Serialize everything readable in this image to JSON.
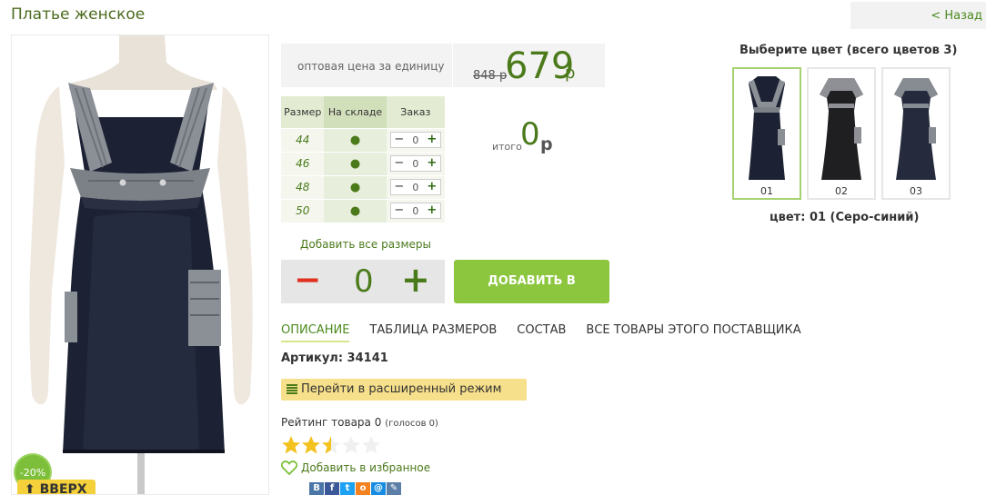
{
  "header": {
    "title": "Платье женское",
    "back_label": "< Назад"
  },
  "photo": {
    "discount": "-20%",
    "up_label": "⬆ ВВЕРХ"
  },
  "price": {
    "label": "оптовая цена за единицу",
    "old": "848 р",
    "new": "679",
    "currency": "р"
  },
  "sizes": {
    "headers": {
      "size": "Размер",
      "stock": "На складе",
      "order": "Заказ"
    },
    "rows": [
      {
        "size": "44",
        "stock": "●",
        "qty": "0"
      },
      {
        "size": "46",
        "stock": "●",
        "qty": "0"
      },
      {
        "size": "48",
        "stock": "●",
        "qty": "0"
      },
      {
        "size": "50",
        "stock": "●",
        "qty": "0"
      }
    ],
    "minus": "−",
    "plus": "+"
  },
  "total": {
    "label": "итого",
    "value": "0",
    "currency": "р"
  },
  "add_all_label": "Добавить все размеры",
  "stepper": {
    "minus": "−",
    "value": "0",
    "plus": "+"
  },
  "cart_button": "ДОБАВИТЬ В КОРЗИНУ",
  "tabs": [
    {
      "label": "ОПИСАНИЕ"
    },
    {
      "label": "ТАБЛИЦА РАЗМЕРОВ"
    },
    {
      "label": "СОСТАВ"
    },
    {
      "label": "ВСЕ ТОВАРЫ ЭТОГО ПОСТАВЩИКА"
    }
  ],
  "sku": "Артикул: 34141",
  "extended_mode": "Перейти в расширенный режим",
  "rating": {
    "label": "Рейтинг товара 0",
    "votes": "(голосов 0)",
    "stars": 2.5,
    "max_stars": 5
  },
  "favorite": "Добавить в избранное",
  "social": [
    {
      "icon": "vk-icon",
      "glyph": "В",
      "color": "#4a76a8"
    },
    {
      "icon": "facebook-icon",
      "glyph": "f",
      "color": "#3b5998"
    },
    {
      "icon": "twitter-icon",
      "glyph": "t",
      "color": "#1da1f2"
    },
    {
      "icon": "odnoklassniki-icon",
      "glyph": "о",
      "color": "#f58220"
    },
    {
      "icon": "mail-icon",
      "glyph": "@",
      "color": "#168de2"
    },
    {
      "icon": "livejournal-icon",
      "glyph": "✎",
      "color": "#5c7fa8"
    }
  ],
  "colors": {
    "title": "Выберите цвет (всего цветов 3)",
    "items": [
      {
        "label": "01",
        "selected": true
      },
      {
        "label": "02",
        "selected": false
      },
      {
        "label": "03",
        "selected": false
      }
    ],
    "current": "цвет: 01 (Серо-синий)"
  },
  "palette": {
    "brand_green": "#4b7a1b",
    "button_green": "#8cc63f",
    "minus_red": "#e0301e",
    "highlight_yellow": "#f7e08b"
  }
}
